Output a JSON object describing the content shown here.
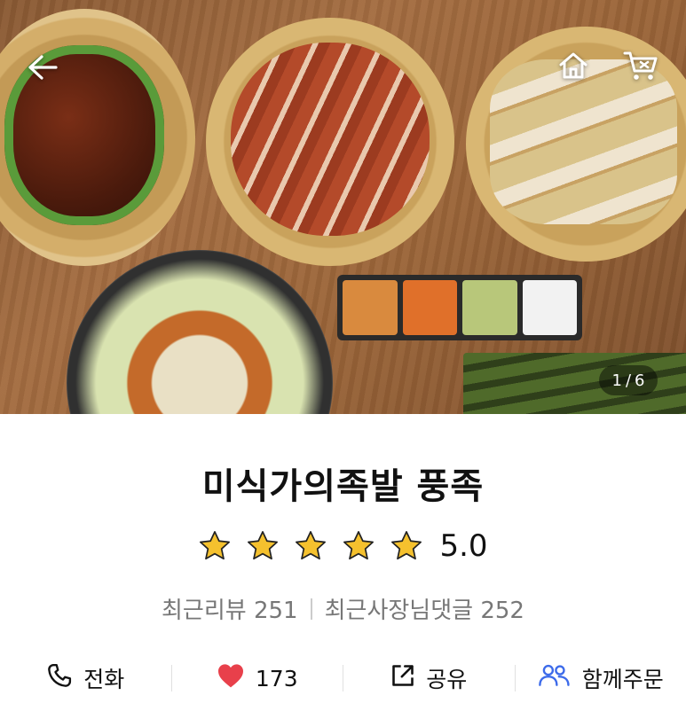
{
  "hero": {
    "counter_current": "1",
    "counter_sep": "/",
    "counter_total": "6"
  },
  "store": {
    "name": "미식가의족발 풍족",
    "rating_value": 5.0,
    "rating_label": "5.0",
    "stars_filled": 5,
    "review_label": "최근리뷰",
    "review_count": "251",
    "owner_reply_label": "최근사장님댓글",
    "owner_reply_count": "252"
  },
  "actions": {
    "call_label": "전화",
    "like_count": "173",
    "share_label": "공유",
    "group_order_label": "함께주문"
  },
  "icons": {
    "back": "arrow-left-icon",
    "home": "home-icon",
    "cart": "cart-icon",
    "star": "star-icon",
    "phone": "phone-icon",
    "heart": "heart-icon",
    "share": "share-icon",
    "group": "group-icon"
  },
  "colors": {
    "star": "#F5C12E",
    "heart": "#E8404B",
    "group_icon": "#3D6BEA",
    "muted_text": "#777777"
  }
}
